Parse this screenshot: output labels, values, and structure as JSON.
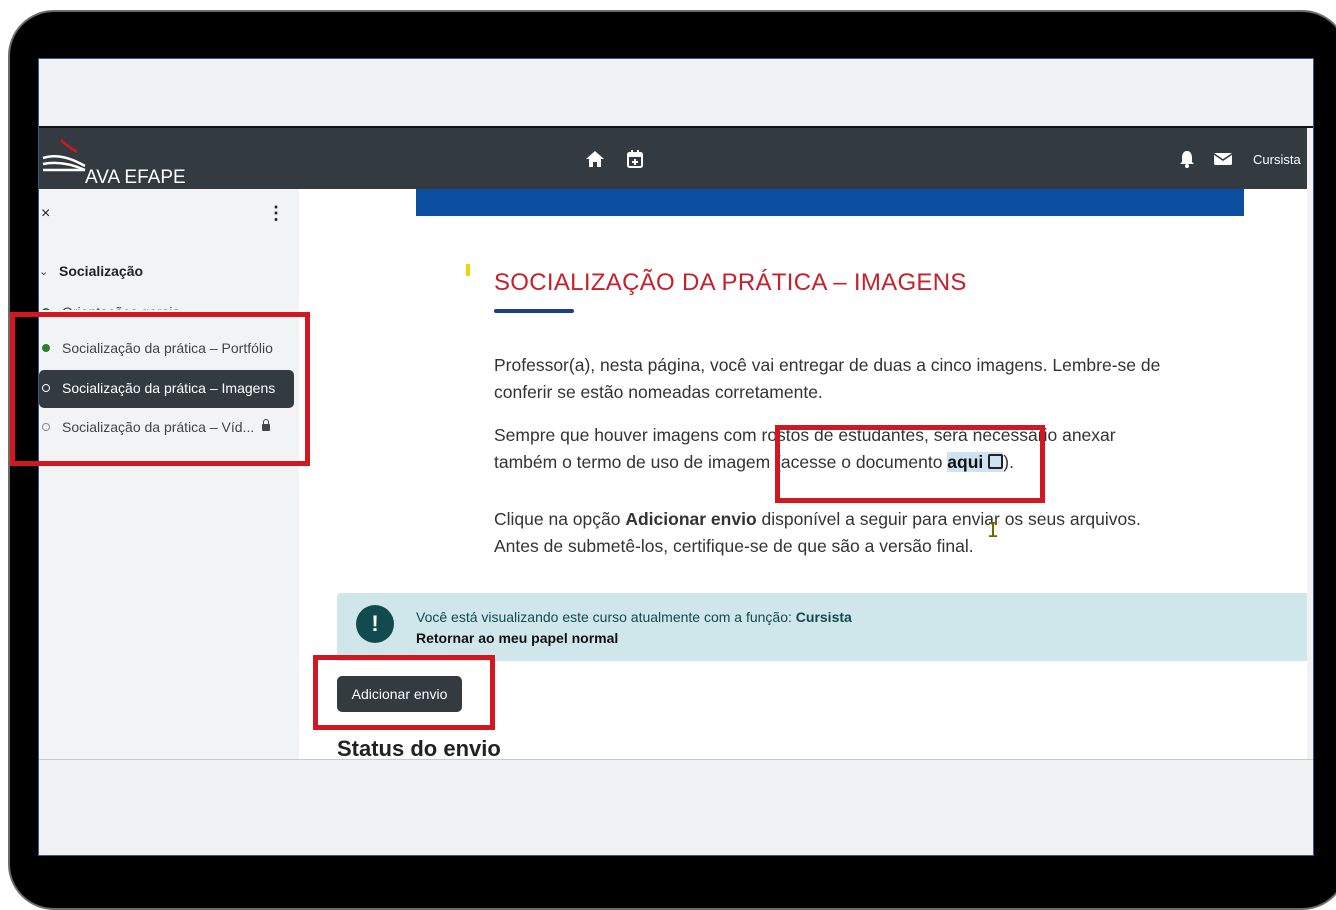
{
  "navbar": {
    "brand": "AVA EFAPE",
    "user_label": "Cursista",
    "icons": [
      "home-icon",
      "calendar-icon",
      "bell-icon",
      "envelope-icon"
    ]
  },
  "drawer": {
    "close_symbol": "×",
    "menu_symbol": "⋮",
    "section_title": "Socialização",
    "items": [
      {
        "label": "Orientações gerais",
        "status": "done"
      },
      {
        "label": "Socialização da prática – Portfólio",
        "status": "done"
      },
      {
        "label": "Socialização da prática – Imagens",
        "status": "current"
      },
      {
        "label": "Socialização da prática – Víd...",
        "status": "locked"
      }
    ]
  },
  "content": {
    "title": "SOCIALIZAÇÃO DA PRÁTICA – IMAGENS",
    "p1": "Professor(a), nesta página, você vai entregar de duas a cinco imagens. Lembre-se de conferir se estão nomeadas corretamente.",
    "p2_before": "Sempre que houver imagens com rostos de estudantes, será necessário anexar também o termo de uso de imagem (acesse o documento ",
    "p2_link": "aqui",
    "p2_after": ").",
    "p3_before": "Clique na opção ",
    "p3_bold": "Adicionar envio",
    "p3_after": " disponível a seguir para enviar os seus arquivos. Antes de submetê-los, certifique-se de que são a versão final."
  },
  "alert": {
    "icon": "!",
    "text": "Você está visualizando este curso atualmente com a função: ",
    "role": "Cursista",
    "return_link": "Retornar ao meu papel normal"
  },
  "actions": {
    "add_submission": "Adicionar envio"
  },
  "submission": {
    "status_heading": "Status do envio"
  },
  "colors": {
    "navbar": "#333a40",
    "title_red": "#c8202a",
    "banner_blue": "#0b4ea0",
    "highlight_red": "#d1171f",
    "alert_bg": "#cfe6ea"
  }
}
